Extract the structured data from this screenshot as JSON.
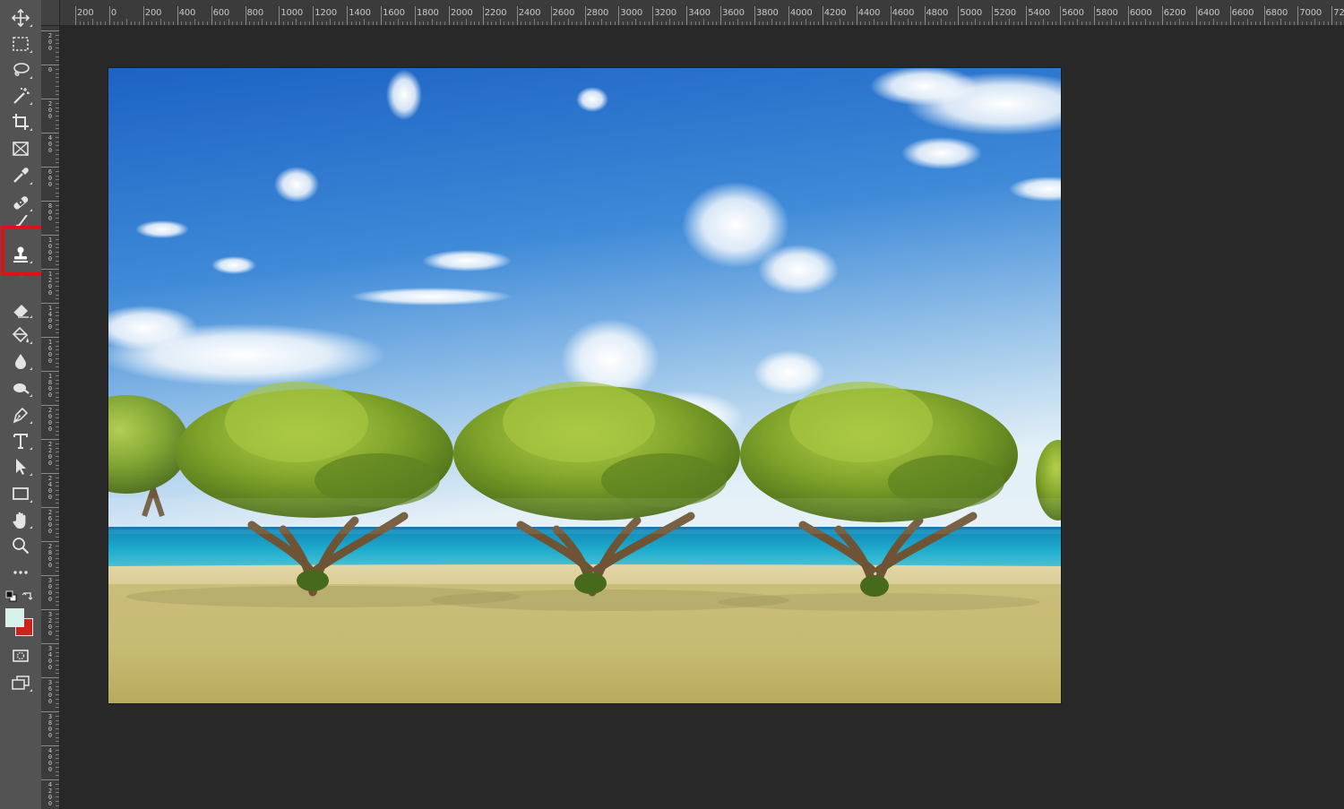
{
  "app": "Photoshop",
  "toolbar": {
    "tools": [
      {
        "id": "move-tool",
        "icon": "move-icon"
      },
      {
        "id": "marquee-tool",
        "icon": "rectangular-marquee-icon"
      },
      {
        "id": "lasso-tool",
        "icon": "lasso-icon"
      },
      {
        "id": "magic-wand-tool",
        "icon": "magic-wand-icon"
      },
      {
        "id": "crop-tool",
        "icon": "crop-icon"
      },
      {
        "id": "frame-tool",
        "icon": "frame-icon"
      },
      {
        "id": "eyedropper-tool",
        "icon": "eyedropper-icon"
      },
      {
        "id": "healing-brush-tool",
        "icon": "bandage-icon"
      },
      {
        "id": "brush-tool",
        "icon": "brush-icon"
      },
      {
        "id": "clone-stamp-tool",
        "icon": "stamp-icon",
        "selected": true
      },
      {
        "id": "history-brush-tool",
        "icon": "history-brush-icon"
      },
      {
        "id": "eraser-tool",
        "icon": "eraser-icon"
      },
      {
        "id": "paint-bucket-tool",
        "icon": "paint-bucket-icon"
      },
      {
        "id": "blur-tool",
        "icon": "water-drop-icon"
      },
      {
        "id": "dodge-tool",
        "icon": "dodge-icon"
      },
      {
        "id": "pen-tool",
        "icon": "pen-icon"
      },
      {
        "id": "type-tool",
        "icon": "type-icon"
      },
      {
        "id": "path-selection-tool",
        "icon": "arrow-cursor-icon"
      },
      {
        "id": "rectangle-tool",
        "icon": "rectangle-icon"
      },
      {
        "id": "hand-tool",
        "icon": "hand-icon"
      },
      {
        "id": "zoom-tool",
        "icon": "zoom-icon"
      },
      {
        "id": "edit-toolbar",
        "icon": "more-icon"
      }
    ],
    "foreground_color": "#d7f1ec",
    "background_color": "#c9241b",
    "highlight_color": "#e0101a"
  },
  "ruler_top": {
    "labels": [
      "200",
      "0",
      "200",
      "400",
      "600",
      "800",
      "1000",
      "1200",
      "1400",
      "1600",
      "1800",
      "2000",
      "2200",
      "2400",
      "2600",
      "2800",
      "3000",
      "3200",
      "3400",
      "3600",
      "3800",
      "4000",
      "4200",
      "4400",
      "4600",
      "4800",
      "5000",
      "5200",
      "5400",
      "5600",
      "5800",
      "6000",
      "6200",
      "6400",
      "6600",
      "6800",
      "7000",
      "720"
    ]
  },
  "ruler_left": {
    "labels": [
      "200",
      "0",
      "200",
      "400",
      "600",
      "800",
      "1000",
      "1200",
      "1400",
      "1600",
      "1800",
      "2000",
      "2200",
      "2400",
      "2600",
      "2800",
      "3000",
      "3200",
      "3400",
      "3600",
      "3800",
      "4000",
      "4200"
    ]
  },
  "canvas": {
    "description_icon": "beach-trees-photo",
    "sky_top": "#1f6fcb",
    "sky_bottom": "#d9ebf5",
    "sea": "#1aa6c9",
    "grass": "#d2c47e"
  }
}
